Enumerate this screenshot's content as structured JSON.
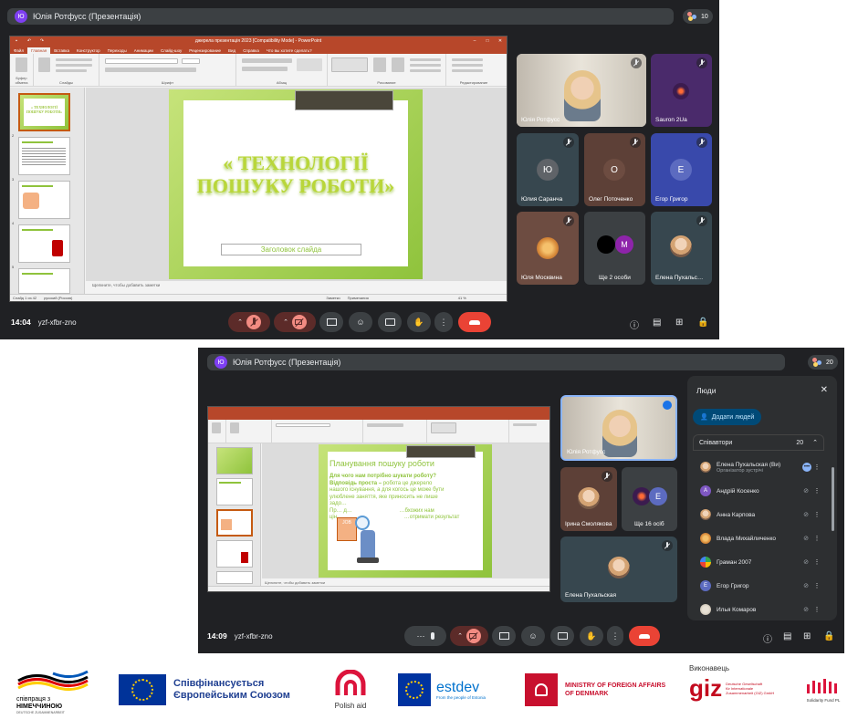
{
  "meet1": {
    "presenter_title": "Юлія Ротфусс (Презентація)",
    "presenter_initial": "Ю",
    "participant_count": "10",
    "time": "14:04",
    "meeting_code": "yzf-xfbr-zno",
    "ppt": {
      "window_title": "джерела презентація 2023 [Compatibility Mode] - PowerPoint",
      "tabs": [
        "Файл",
        "Главная",
        "Вставка",
        "Конструктор",
        "Переходы",
        "Анимации",
        "Слайд-шоу",
        "Рецензирование",
        "Вид",
        "Справка",
        "Что вы хотите сделать?"
      ],
      "ribbon_groups": [
        "Буфер обмена",
        "Слайды",
        "Шрифт",
        "Абзац",
        "Рисование",
        "Редактирование"
      ],
      "slide_title": "« ТЕХНОЛОГІЇ ПОШУКУ РОБОТИ»",
      "slide_subtitle": "Заголовок слайда",
      "notes_placeholder": "Щелкните, чтобы добавить заметки",
      "status_slide": "Слайд 1 из 42",
      "status_lang": "русский (Россия)",
      "status_notes": "Заметки",
      "status_comments": "Примечания",
      "zoom": "41 %",
      "thumb_numbers": [
        "1",
        "2",
        "3",
        "4",
        "5"
      ],
      "thumb1_text": "« ТЕХНОЛОГІЇ ПОШУКУ РОБОТИ»"
    },
    "tiles": [
      {
        "name": "Юлія Ротфусс"
      },
      {
        "name": "Sauron 2Ua"
      },
      {
        "name": "Юлия Саранча",
        "letter": "Ю",
        "color": "#5f6368"
      },
      {
        "name": "Олег Поточенко",
        "letter": "О",
        "color": "#6d4c41"
      },
      {
        "name": "Егор Григор",
        "letter": "Е",
        "color": "#5c6bc0"
      },
      {
        "name": "Юля Москвина"
      },
      {
        "name": "Ще 2 особи",
        "letter": "М",
        "color": "#8e24aa"
      },
      {
        "name": "Елена Пухальс…"
      }
    ]
  },
  "meet2": {
    "presenter_title": "Юлія Ротфусс (Презентація)",
    "presenter_initial": "Ю",
    "participant_count": "20",
    "time": "14:09",
    "meeting_code": "yzf-xfbr-zno",
    "ppt": {
      "slide_title": "Планування пошуку роботи",
      "slide_q": "Для чого нам потрібно шукати роботу?",
      "slide_line1_bold": "Відповідь проста –",
      "slide_line1": " робота це джерело",
      "slide_line2": "нашого існування, а для когось це може бути",
      "slide_line3": "улюблене заняття, яке приносить не лише",
      "slide_line4": "задо…",
      "slide_line5a": "Пр…",
      "slide_line5b": "д…",
      "slide_line5c": "…бхожих нам",
      "slide_line6a": "цін…",
      "slide_line6b": "…отримати результат",
      "job_sign": "JOB",
      "notes_placeholder": "Щелкните, чтобы добавить заметки",
      "thumb_numbers": [
        "1",
        "2",
        "3",
        "4",
        "5"
      ]
    },
    "tiles": [
      {
        "name": "Юлія Ротфусс"
      },
      {
        "name": "Ірина Смолякова"
      },
      {
        "name": "Ще 16 осіб",
        "letter": "Е",
        "color": "#5c6bc0"
      },
      {
        "name": "Елена Пухальская"
      }
    ],
    "people_panel": {
      "title": "Люди",
      "add_button": "Додати людей",
      "section": "Співавтори",
      "count": "20",
      "list": [
        {
          "name": "Елена Пухальская (Ви)",
          "sub": "Організатор зустрічі"
        },
        {
          "name": "Андрій Косенко",
          "letter": "А",
          "color": "#7e57c2"
        },
        {
          "name": "Анна Карпова"
        },
        {
          "name": "Влада Михайличенко"
        },
        {
          "name": "Граман 2007"
        },
        {
          "name": "Егор Григор",
          "letter": "Е",
          "color": "#5c6bc0"
        },
        {
          "name": "Илья Комаров"
        }
      ]
    }
  },
  "logos": {
    "germany_line1": "співпраця з",
    "germany_line2": "НІМЕЧЧИНОЮ",
    "germany_line3": "DEUTSCHE ZUSAMMENARBEIT",
    "eu_line1": "Співфінансується",
    "eu_line2": "Європейським Союзом",
    "polish": "Polish aid",
    "estdev": "estdev",
    "estdev_sub": "From the people of Estonia",
    "denmark_line1": "MINISTRY OF FOREIGN AFFAIRS",
    "denmark_line2": "OF DENMARK",
    "executor": "Виконавець",
    "giz": "giz",
    "giz_line1": "Deutsche Gesellschaft",
    "giz_line2": "für Internationale",
    "giz_line3": "Zusammenarbeit (GIZ) GmbH",
    "solidarity": "Solidarity Fund PL"
  }
}
